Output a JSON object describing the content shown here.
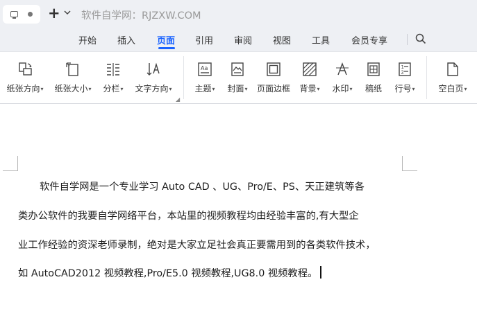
{
  "titlebar": {
    "title": "软件自学网：RJZXW.COM",
    "new_tab": "+"
  },
  "menu": {
    "tabs": [
      {
        "label": "开始",
        "active": false
      },
      {
        "label": "插入",
        "active": false
      },
      {
        "label": "页面",
        "active": true
      },
      {
        "label": "引用",
        "active": false
      },
      {
        "label": "审阅",
        "active": false
      },
      {
        "label": "视图",
        "active": false
      },
      {
        "label": "工具",
        "active": false
      },
      {
        "label": "会员专享",
        "active": false
      }
    ],
    "accent_color": "#1a63ff"
  },
  "ribbon": {
    "buttons": [
      {
        "label": "纸张方向",
        "icon": "page-orientation-icon",
        "dropdown": true
      },
      {
        "label": "纸张大小",
        "icon": "paper-size-icon",
        "dropdown": true
      },
      {
        "label": "分栏",
        "icon": "columns-icon",
        "dropdown": true
      },
      {
        "label": "文字方向",
        "icon": "text-direction-icon",
        "dropdown": true
      },
      {
        "label": "主题",
        "icon": "theme-icon",
        "dropdown": true
      },
      {
        "label": "封面",
        "icon": "cover-page-icon",
        "dropdown": true
      },
      {
        "label": "页面边框",
        "icon": "page-border-icon",
        "dropdown": false
      },
      {
        "label": "背景",
        "icon": "background-icon",
        "dropdown": true
      },
      {
        "label": "水印",
        "icon": "watermark-icon",
        "dropdown": true
      },
      {
        "label": "稿纸",
        "icon": "manuscript-paper-icon",
        "dropdown": false
      },
      {
        "label": "行号",
        "icon": "line-numbers-icon",
        "dropdown": true
      },
      {
        "label": "空白页",
        "icon": "blank-page-icon",
        "dropdown": true
      }
    ]
  },
  "document": {
    "lines": [
      "软件自学网是一个专业学习 Auto CAD 、UG、Pro/E、PS、天正建筑等各",
      "类办公软件的我要自学网络平台，本站里的视频教程均由经验丰富的,有大型企",
      "业工作经验的资深老师录制，绝对是大家立足社会真正要需用到的各类软件技术，",
      "如 AutoCAD2012 视频教程,Pro/E5.0 视频教程,UG8.0 视频教程。"
    ]
  }
}
